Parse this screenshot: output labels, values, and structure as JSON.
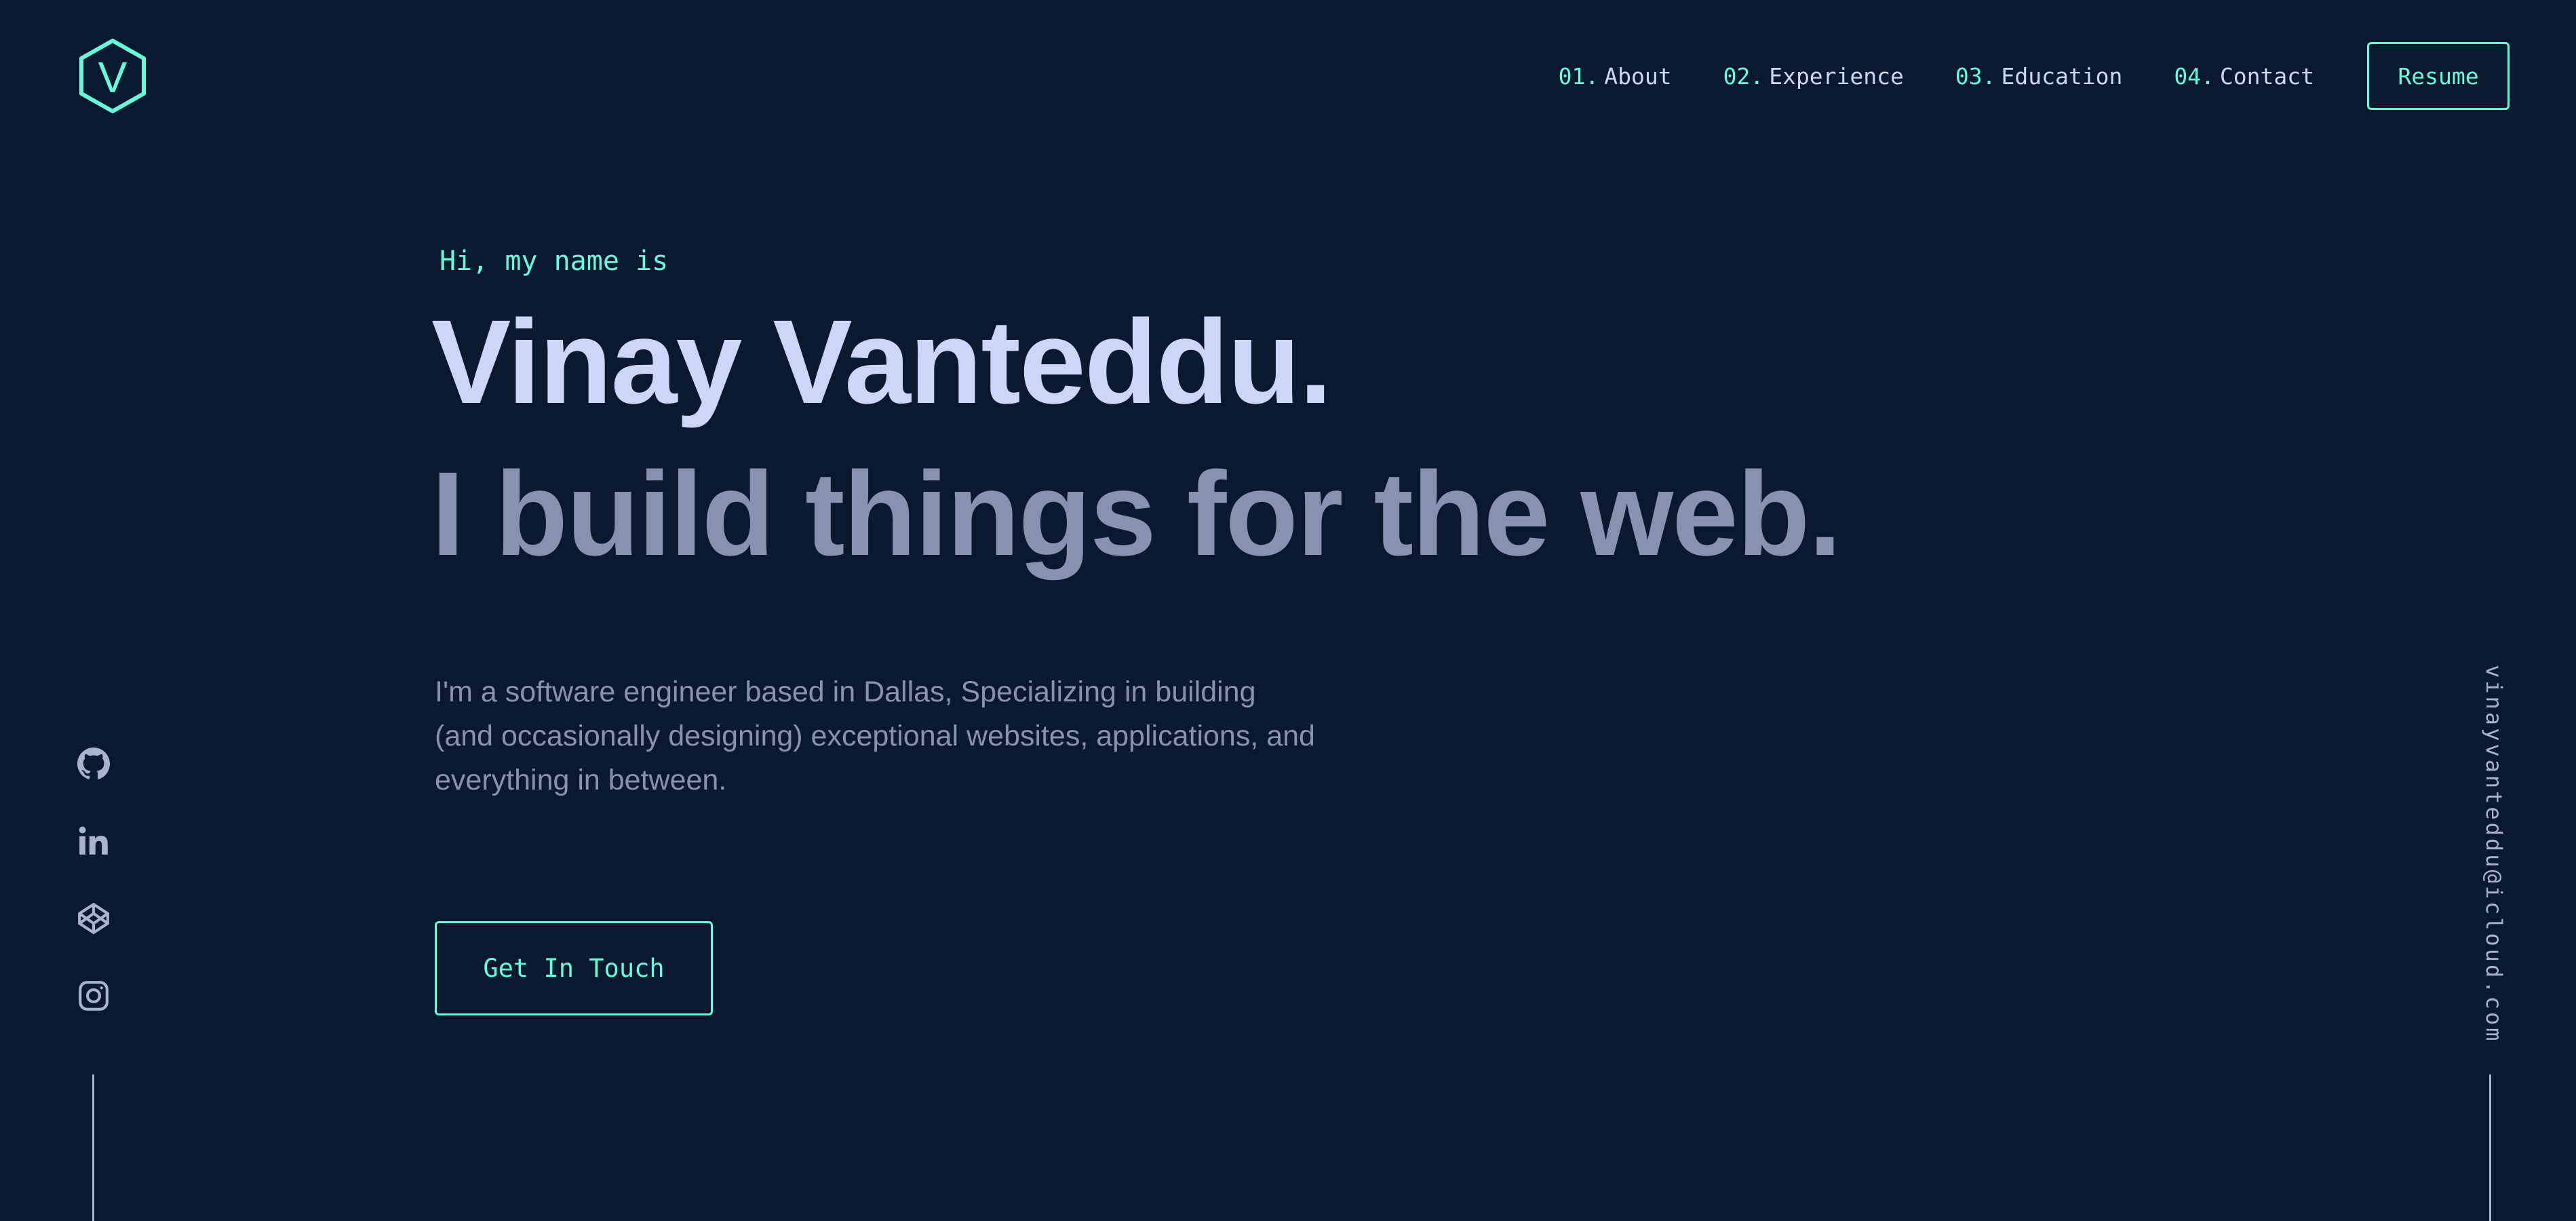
{
  "logo": {
    "letter": "V"
  },
  "nav": {
    "items": [
      {
        "num": "01.",
        "label": "About"
      },
      {
        "num": "02.",
        "label": "Experience"
      },
      {
        "num": "03.",
        "label": "Education"
      },
      {
        "num": "04.",
        "label": "Contact"
      }
    ],
    "resume_label": "Resume"
  },
  "hero": {
    "greeting": "Hi, my name is",
    "name": "Vinay Vanteddu.",
    "tagline": "I build things for the web.",
    "description": "I'm a software engineer based in Dallas, Specializing in building (and occasionally designing) exceptional websites, applications, and everything in between.",
    "cta_label": "Get In Touch"
  },
  "social": {
    "icons": [
      "github-icon",
      "linkedin-icon",
      "codepen-icon",
      "instagram-icon"
    ]
  },
  "email": "vinayvanteddu@icloud.com",
  "colors": {
    "background": "#0a192f",
    "accent": "#64ffda",
    "heading": "#ccd6f6",
    "text": "#8892b0",
    "light": "#a8b2d1"
  }
}
